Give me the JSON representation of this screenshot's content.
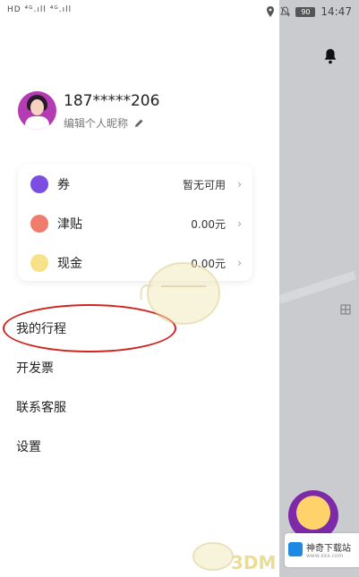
{
  "status_bar": {
    "left_text": "HD ⁴ᴳ.ıll ⁴ᴳ.ıll",
    "battery_label": "90",
    "time": "14:47"
  },
  "profile": {
    "phone_masked": "187*****206",
    "edit_nickname_label": "编辑个人昵称"
  },
  "wallet": [
    {
      "label": "券",
      "value": "暂无可用",
      "icon": "coupon-icon",
      "icon_color": "#7b4de0"
    },
    {
      "label": "津贴",
      "value": "0.00元",
      "icon": "allowance-icon",
      "icon_color": "#f07c6b"
    },
    {
      "label": "现金",
      "value": "0.00元",
      "icon": "cash-icon",
      "icon_color": "#f7e28a"
    }
  ],
  "menu": [
    {
      "label": "我的行程"
    },
    {
      "label": "开发票"
    },
    {
      "label": "联系客服"
    },
    {
      "label": "设置"
    }
  ],
  "watermark_text": "3DM",
  "download_card": {
    "title": "神奇下载站",
    "subtitle": "www.xxx.com"
  },
  "colors": {
    "circle_annotation": "#d0261f",
    "map_bg": "#c9cbcf"
  }
}
